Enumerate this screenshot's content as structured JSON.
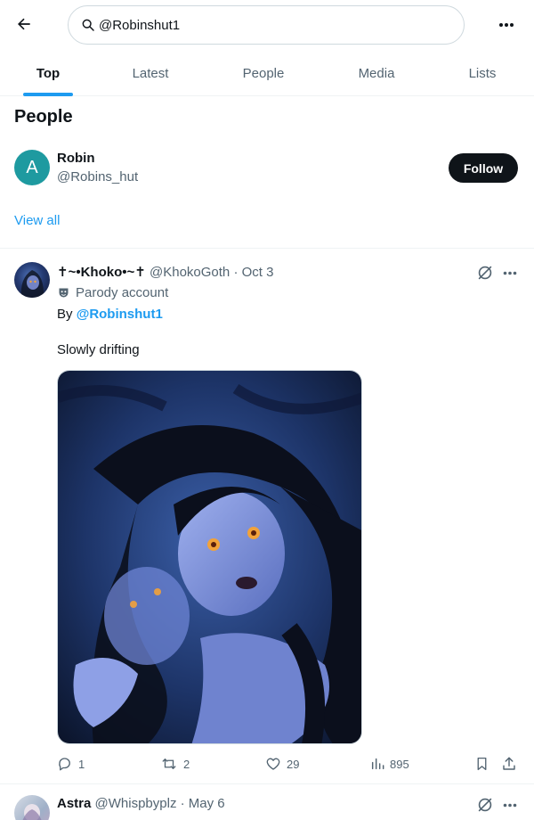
{
  "search": {
    "query": "@Robinshut1"
  },
  "tabs": [
    {
      "label": "Top",
      "active": true
    },
    {
      "label": "Latest",
      "active": false
    },
    {
      "label": "People",
      "active": false
    },
    {
      "label": "Media",
      "active": false
    },
    {
      "label": "Lists",
      "active": false
    }
  ],
  "people": {
    "title": "People",
    "user": {
      "avatar_letter": "A",
      "name": "Robin",
      "handle": "@Robins_hut",
      "follow_label": "Follow"
    },
    "view_all": "View all"
  },
  "post1": {
    "name": "✝~•Khoko•~✝",
    "handle": "@KhokoGoth",
    "sep": " · ",
    "date": "Oct 3",
    "parody_label": "Parody account",
    "by_prefix": "By ",
    "mention": "@Robinshut1",
    "text": "Slowly drifting",
    "stats": {
      "replies": "1",
      "reposts": "2",
      "likes": "29",
      "views": "895"
    }
  },
  "post2": {
    "name": "Astra",
    "handle": "@Whispbyplz",
    "sep": " · ",
    "date": "May 6"
  },
  "colors": {
    "accent": "#1d9bf0",
    "text": "#0f1419",
    "muted": "#536471",
    "border": "#eff3f4",
    "follow_bg": "#0f1419",
    "avatar_bg": "#1e9aa0"
  },
  "icons": [
    "back-arrow-icon",
    "search-icon",
    "more-icon",
    "parody-mask-icon",
    "grok-icon",
    "reply-icon",
    "repost-icon",
    "like-icon",
    "views-icon",
    "bookmark-icon",
    "share-icon"
  ]
}
